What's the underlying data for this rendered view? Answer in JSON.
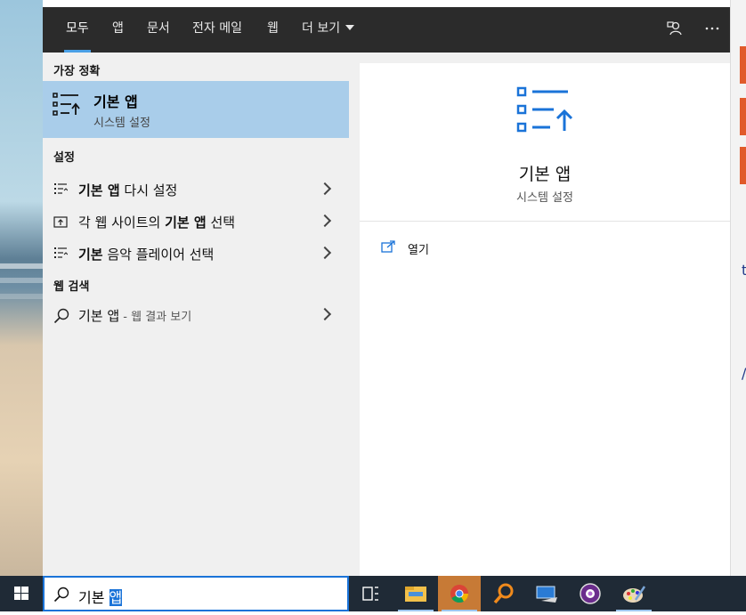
{
  "tabs": [
    {
      "label": "모두",
      "active": true
    },
    {
      "label": "앱"
    },
    {
      "label": "문서"
    },
    {
      "label": "전자 메일"
    },
    {
      "label": "웹"
    },
    {
      "label": "더 보기"
    }
  ],
  "top_icons": [
    "feedback-icon",
    "more-options-icon"
  ],
  "sections": {
    "best_match": "가장 정확",
    "settings": "설정",
    "web_search": "웹 검색"
  },
  "best_match": {
    "title": "기본 앱",
    "subtitle": "시스템 설정",
    "icon": "default-apps-icon"
  },
  "settings_results": [
    {
      "bold": "기본 앱",
      "rest": " 다시 설정",
      "icon": "list-settings-icon"
    },
    {
      "pre": "각 웹 사이트의 ",
      "bold": "기본 앱",
      "rest": " 선택",
      "icon": "web-app-icon"
    },
    {
      "bold": "기본",
      "rest": " 음악 플레이어 선택",
      "icon": "list-settings-icon"
    }
  ],
  "web_result": {
    "query": "기본 앱",
    "suffix": " - 웹 결과 보기",
    "icon": "search-icon"
  },
  "preview": {
    "title": "기본 앱",
    "subtitle": "시스템 설정",
    "action_label": "열기",
    "action_icon": "open-icon"
  },
  "search": {
    "typed": "기본 ",
    "selected": "앱"
  },
  "taskbar_icons": [
    "windows-start-icon",
    "task-view-icon",
    "file-explorer-icon",
    "chrome-icon",
    "search-tool-icon",
    "remote-desktop-icon",
    "media-app-icon",
    "paint-icon"
  ],
  "colors": {
    "accent": "#1a73d8",
    "highlight": "#a9cdea",
    "topbar": "#2b2b2b",
    "taskbar": "#1f2a36"
  }
}
